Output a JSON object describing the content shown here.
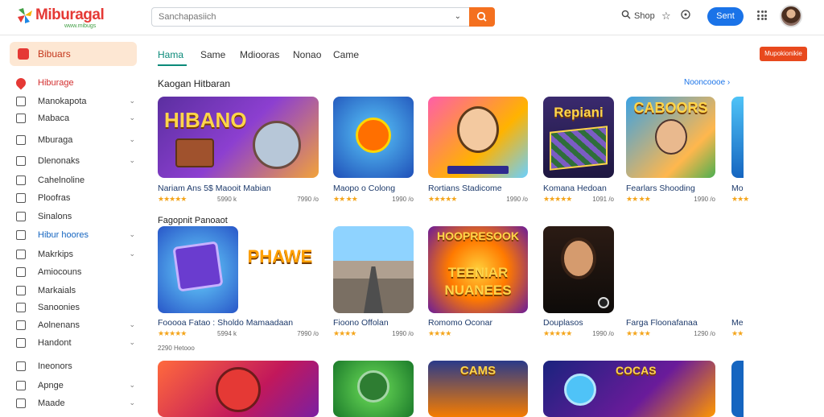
{
  "header": {
    "logo_text": "Miburagal",
    "logo_sub": "www.mibugs",
    "search_placeholder": "Sanchapasiich",
    "shop_label": "Shop",
    "signin_label": "Sent"
  },
  "sidebar": {
    "head_label": "Bibuars",
    "items": [
      {
        "label": "Hiburage",
        "chev": ""
      },
      {
        "label": "Manokapota",
        "chev": "⌄"
      },
      {
        "label": "Mabaca",
        "chev": "⌄"
      },
      {
        "label": "Mburaga",
        "chev": "⌄"
      },
      {
        "label": "Dlenonaks",
        "chev": "⌄"
      },
      {
        "label": "Cahelnoline",
        "chev": ""
      },
      {
        "label": "Ploofras",
        "chev": ""
      },
      {
        "label": "Sinalons",
        "chev": ""
      },
      {
        "label": "Hibur hoores",
        "chev": "⌄"
      },
      {
        "label": "Makrkips",
        "chev": "⌄"
      },
      {
        "label": "Amiocouns",
        "chev": ""
      },
      {
        "label": "Markaials",
        "chev": ""
      },
      {
        "label": "Sanoonies",
        "chev": ""
      },
      {
        "label": "Aolnenans",
        "chev": "⌄"
      },
      {
        "label": "Handont",
        "chev": "⌄"
      },
      {
        "label": "Ineonors",
        "chev": ""
      },
      {
        "label": "Apnge",
        "chev": "⌄"
      },
      {
        "label": "Maade",
        "chev": "⌄"
      }
    ]
  },
  "tabs": [
    "Hama",
    "Same",
    "Mdiooras",
    "Nonao",
    "Came"
  ],
  "promo_label": "Mupokionikie",
  "sections": {
    "s1_title": "Kaogan Hitbaran",
    "see_all": "Nooncoooe ›",
    "s2_title": "Fagopnit Panoaot"
  },
  "row1": [
    {
      "title": "Nariam Ans 5$ Maooit Mabian",
      "stars": "★★★★★",
      "meta": "5990 k",
      "size": "7990 /o"
    },
    {
      "title": "Maopo o Colong",
      "stars": "★★ ★★",
      "meta": "",
      "size": "1990 /o"
    },
    {
      "title": "Rortians Stadicome",
      "stars": "★★★★★",
      "meta": "",
      "size": "1990 /o"
    },
    {
      "title": "Komana Hedoan",
      "stars": "★★★★★",
      "meta": "",
      "size": "1091 /o"
    },
    {
      "title": "Fearlars Shooding",
      "stars": "★★ ★★",
      "meta": "",
      "size": "1990 /o"
    },
    {
      "title": "Mo",
      "stars": "★★★",
      "meta": "",
      "size": ""
    }
  ],
  "row2": [
    {
      "title": "Fooooa Fatao : Sholdo Mamaadaan",
      "stars": "★★★★★",
      "meta": "5994 k",
      "size": "7990 /o",
      "meta2": "2290 Hetooo"
    },
    {
      "title": "Fioono Offolan",
      "stars": "★★★★",
      "meta": "",
      "size": "1990 /o"
    },
    {
      "title": "Romomo Oconar",
      "stars": "★★★★",
      "meta": "",
      "size": ""
    },
    {
      "title": "Douplasos",
      "stars": "★★★★★",
      "meta": "",
      "size": "1990 /o"
    },
    {
      "title": "Farga Floonafanaa",
      "stars": "★★ ★★",
      "meta": "",
      "size": "1290 /o"
    },
    {
      "title": "Me",
      "stars": "★★",
      "meta": "",
      "size": ""
    }
  ],
  "art_text": {
    "r1a": "HIBANO",
    "r1d": "Repiani",
    "r1e": "CABOORS",
    "r2a": "PHAWE",
    "r2c1": "HOOPRESOOK",
    "r2c2": "TEENIAR",
    "r2c3": "NUANEES",
    "r3c": "CAMS",
    "r3d": "COCAS"
  },
  "colors": {
    "accent": "#0b8a7a",
    "brand": "#e53935",
    "orange": "#f4701f",
    "link": "#1a73e8"
  }
}
